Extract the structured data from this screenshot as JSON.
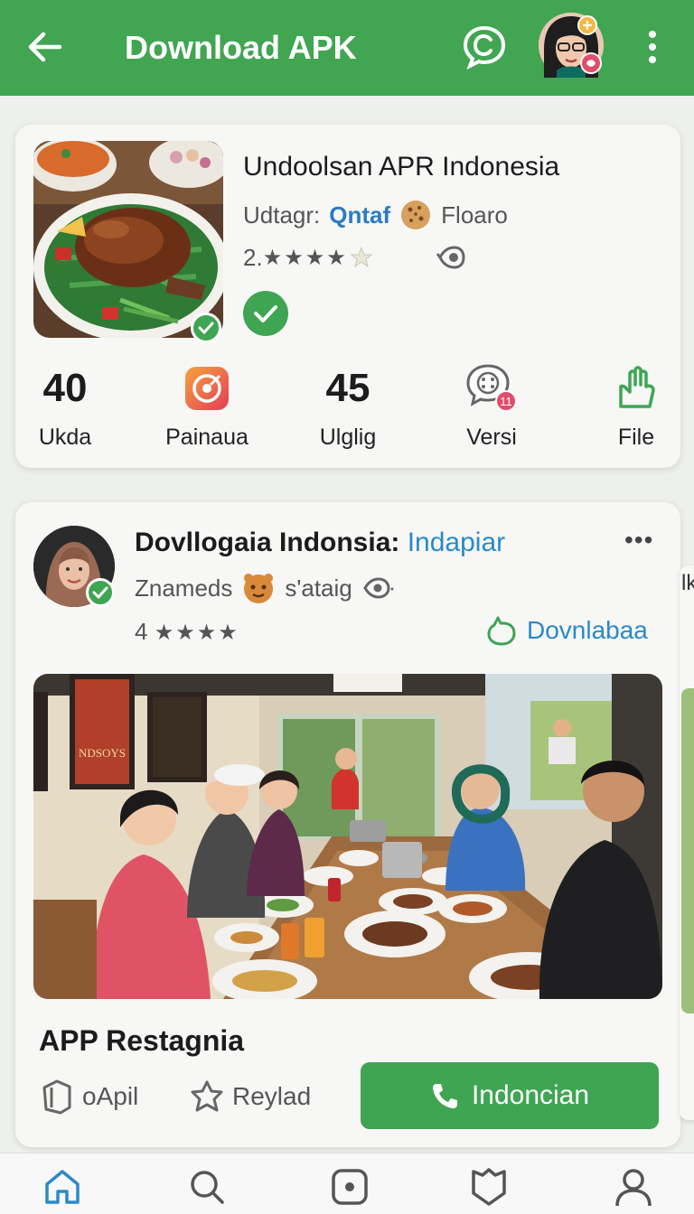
{
  "header": {
    "title": "Download APK",
    "back_icon": "arrow-left-icon",
    "chat_icon": "chat-bubble-icon",
    "menu_icon": "more-vertical-icon",
    "bg_color": "#41a552"
  },
  "app_card": {
    "title": "Undoolsan APR Indonesia",
    "meta_prefix": "Udtagr:",
    "meta_link": "Qntaf",
    "meta_suffix": "Floaro",
    "rating": "2.",
    "stars": "★★★★",
    "stats": [
      {
        "value": "40",
        "label": "Ukda"
      },
      {
        "label": "Painaua",
        "icon": "target-app-icon"
      },
      {
        "value": "45",
        "label": "Ulglig"
      },
      {
        "label": "Versi",
        "icon": "chat-support-icon",
        "badge": "11"
      },
      {
        "label": "File",
        "icon": "hand-icon"
      }
    ]
  },
  "post_card": {
    "title": "Dovllogaia Indonsia:",
    "title_link": "Indapiar",
    "more": "•••",
    "sub_left": "Znameds",
    "sub_right": "s'ataig",
    "rating": "4",
    "stars": "★★★★",
    "download_link": "Dovnlabaa",
    "app_name": "APP Restagnia",
    "action_1": "oApil",
    "action_2": "Reylad",
    "cta_label": "Indoncian",
    "peek_text": "lk"
  },
  "bottom_nav": {
    "items": [
      "home-icon",
      "search-icon",
      "record-icon",
      "bookmark-icon",
      "profile-icon"
    ]
  }
}
